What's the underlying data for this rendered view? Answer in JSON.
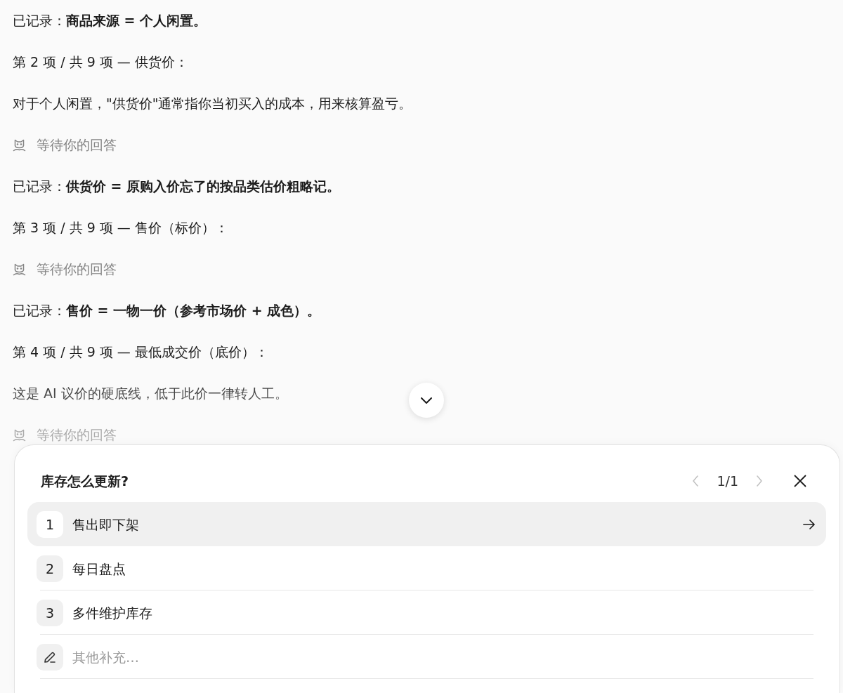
{
  "messages": [
    {
      "kind": "recorded",
      "text": "已记录：**商品来源 = 个人闲置。**"
    },
    {
      "kind": "text",
      "text": "第 2 项 / 共 9 项 — 供货价："
    },
    {
      "kind": "text",
      "text": "对于个人闲置，\"供货价\"通常指你当初买入的成本，用来核算盈亏。"
    },
    {
      "kind": "waiting",
      "text": "等待你的回答"
    },
    {
      "kind": "recorded",
      "text": "已记录：**供货价 = 原购入价忘了的按品类估价粗略记。**"
    },
    {
      "kind": "text",
      "text": "第 3 项 / 共 9 项 — 售价（标价）："
    },
    {
      "kind": "waiting",
      "text": "等待你的回答"
    },
    {
      "kind": "recorded",
      "text": "已记录：**售价 = 一物一价（参考市场价 + 成色）。**"
    },
    {
      "kind": "text",
      "text": "第 4 项 / 共 9 项 — 最低成交价（底价）："
    },
    {
      "kind": "text",
      "text": "这是 AI 议价的硬底线，低于此价一律转人工。"
    },
    {
      "kind": "waiting",
      "text": "等待你的回答"
    }
  ],
  "question": {
    "title": "库存怎么更新?",
    "pager": {
      "text": "1/1",
      "prev_disabled": true,
      "next_disabled": true
    },
    "options": [
      {
        "number": "1",
        "label": "售出即下架",
        "selected": true
      },
      {
        "number": "2",
        "label": "每日盘点",
        "selected": false
      },
      {
        "number": "3",
        "label": "多件维护库存",
        "selected": false
      }
    ],
    "other": {
      "placeholder": "其他补充…"
    }
  }
}
